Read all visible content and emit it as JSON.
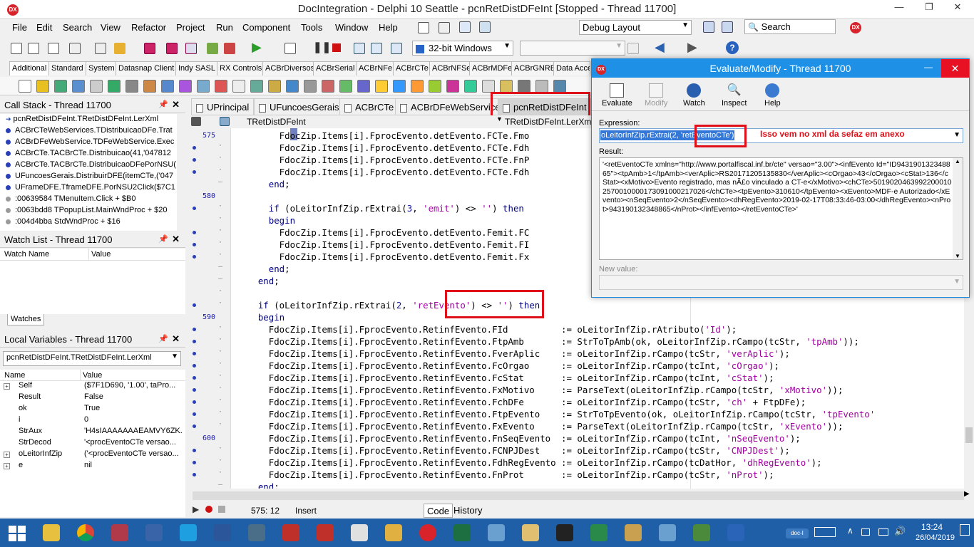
{
  "window": {
    "title": "DocIntegration - Delphi 10 Seattle - pcnRetDistDFeInt [Stopped - Thread 11700]",
    "minimize": "—",
    "restore": "❐",
    "close": "✕"
  },
  "menu": [
    "File",
    "Edit",
    "Search",
    "View",
    "Refactor",
    "Project",
    "Run",
    "Component",
    "Tools",
    "Window",
    "Help"
  ],
  "toolbar": {
    "layout_combo": "Debug Layout",
    "search_placeholder": "Search",
    "platform_combo": "32-bit Windows"
  },
  "palette_tabs": [
    "Additional",
    "Standard",
    "System",
    "Datasnap Client",
    "Indy SASL",
    "RX Controls",
    "ACBrDiversos",
    "ACBrSerial",
    "ACBrNFe",
    "ACBrCTe",
    "ACBrNFSe",
    "ACBrMDFe",
    "ACBrGNRE",
    "Data Acce"
  ],
  "call_stack": {
    "title": "Call Stack - Thread 11700",
    "items": [
      {
        "text": "pcnRetDistDFeInt.TRetDistDFeInt.LerXml",
        "type": "arrow"
      },
      {
        "text": "ACBrCTeWebServices.TDistribuicaoDFe.Trat",
        "type": "blue"
      },
      {
        "text": "ACBrDFeWebService.TDFeWebService.Exec",
        "type": "blue"
      },
      {
        "text": "ACBrCTe.TACBrCTe.Distribuicao(41,'047812",
        "type": "blue"
      },
      {
        "text": "ACBrCTe.TACBrCTe.DistribuicaoDFePorNSU(",
        "type": "blue"
      },
      {
        "text": "UFuncoesGerais.DistribuirDFE(itemCTe,('047",
        "type": "blue"
      },
      {
        "text": "UFrameDFE.TframeDFE.PorNSU2Click($7C1",
        "type": "blue"
      },
      {
        "text": ":00639584 TMenuItem.Click + $B0",
        "type": "gray"
      },
      {
        "text": ":0063bdd8 TPopupList.MainWndProc + $20",
        "type": "gray"
      },
      {
        "text": ":004d4bba StdWndProc + $16",
        "type": "gray"
      }
    ]
  },
  "watch_list": {
    "title": "Watch List - Thread 11700",
    "col_name": "Watch Name",
    "col_value": "Value",
    "tab": "Watches"
  },
  "local_vars": {
    "title": "Local Variables - Thread 11700",
    "scope": "pcnRetDistDFeInt.TRetDistDFeInt.LerXml",
    "col_name": "Name",
    "col_value": "Value",
    "rows": [
      {
        "name": "Self",
        "value": "($7F1D690, '1.00', taPro...",
        "expand": true
      },
      {
        "name": "Result",
        "value": "False",
        "expand": false
      },
      {
        "name": "ok",
        "value": "True",
        "expand": false
      },
      {
        "name": "i",
        "value": "0",
        "expand": false
      },
      {
        "name": "StrAux",
        "value": "'H4sIAAAAAAAEAMVY6ZK...",
        "expand": false
      },
      {
        "name": "StrDecod",
        "value": "'<procEventoCTe versao...",
        "expand": false
      },
      {
        "name": "oLeitorInfZip",
        "value": "('<procEventoCTe versao...",
        "expand": true
      },
      {
        "name": "e",
        "value": "nil",
        "expand": true
      }
    ]
  },
  "editor_tabs": [
    "UPrincipal",
    "UFuncoesGerais",
    "ACBrCTe",
    "ACBrDFeWebService",
    "pcnRetDistDFeInt"
  ],
  "editor_nav": {
    "class_combo": "TRetDistDFeInt",
    "method_combo": "TRetDistDFeInt.LerXm"
  },
  "line_numbers": [
    {
      "n": "575",
      "row": 0
    },
    {
      "n": "580",
      "row": 5
    },
    {
      "n": "590",
      "row": 15
    },
    {
      "n": "600",
      "row": 25
    }
  ],
  "code_lines": [
    "        FdocZip.Items[i].FprocEvento.detEvento.FCTe.Fmo",
    "        FdocZip.Items[i].FprocEvento.detEvento.FCTe.Fdh",
    "        FdocZip.Items[i].FprocEvento.detEvento.FCTe.FnP",
    "        FdocZip.Items[i].FprocEvento.detEvento.FCTe.Fdh",
    "      end;",
    "",
    "      if (oLeitorInfZip.rExtrai(3, 'emit') <> '') then",
    "      begin",
    "        FdocZip.Items[i].FprocEvento.detEvento.Femit.FC",
    "        FdocZip.Items[i].FprocEvento.detEvento.Femit.FI",
    "        FdocZip.Items[i].FprocEvento.detEvento.Femit.Fx",
    "      end;",
    "    end;",
    "",
    "    if (oLeitorInfZip.rExtrai(2, 'retEvento') <> '') then",
    "    begin",
    "      FdocZip.Items[i].FprocEvento.RetinfEvento.FId          := oLeitorInfZip.rAtributo('Id');",
    "      FdocZip.Items[i].FprocEvento.RetinfEvento.FtpAmb       := StrToTpAmb(ok, oLeitorInfZip.rCampo(tcStr, 'tpAmb'));",
    "      FdocZip.Items[i].FprocEvento.RetinfEvento.FverAplic    := oLeitorInfZip.rCampo(tcStr, 'verAplic');",
    "      FdocZip.Items[i].FprocEvento.RetinfEvento.FcOrgao      := oLeitorInfZip.rCampo(tcInt, 'cOrgao');",
    "      FdocZip.Items[i].FprocEvento.RetinfEvento.FcStat       := oLeitorInfZip.rCampo(tcInt, 'cStat');",
    "      FdocZip.Items[i].FprocEvento.RetinfEvento.FxMotivo     := ParseText(oLeitorInfZip.rCampo(tcStr, 'xMotivo'));",
    "      FdocZip.Items[i].FprocEvento.RetinfEvento.FchDFe       := oLeitorInfZip.rCampo(tcStr, 'ch' + FtpDFe);",
    "      FdocZip.Items[i].FprocEvento.RetinfEvento.FtpEvento    := StrToTpEvento(ok, oLeitorInfZip.rCampo(tcStr, 'tpEvento'",
    "      FdocZip.Items[i].FprocEvento.RetinfEvento.FxEvento     := ParseText(oLeitorInfZip.rCampo(tcStr, 'xEvento'));",
    "      FdocZip.Items[i].FprocEvento.RetinfEvento.FnSeqEvento  := oLeitorInfZip.rCampo(tcInt, 'nSeqEvento');",
    "      FdocZip.Items[i].FprocEvento.RetinfEvento.FCNPJDest    := oLeitorInfZip.rCampo(tcStr, 'CNPJDest');",
    "      FdocZip.Items[i].FprocEvento.RetinfEvento.FdhRegEvento := oLeitorInfZip.rCampo(tcDatHor, 'dhRegEvento');",
    "      FdocZip.Items[i].FprocEvento.RetinfEvento.FnProt       := oLeitorInfZip.rCampo(tcStr, 'nProt');",
    "    end;"
  ],
  "status": {
    "pos": "575: 12",
    "mode": "Insert",
    "tab_code": "Code",
    "tab_history": "History"
  },
  "evaluate": {
    "title": "Evaluate/Modify - Thread 11700",
    "buttons": [
      "Evaluate",
      "Modify",
      "Watch",
      "Inspect",
      "Help"
    ],
    "expression_label": "Expression:",
    "expression": "oLeitorInfZip.rExtrai(2, 'retEventoCTe')",
    "annotation": "Isso vem no xml da sefaz em anexo",
    "result_label": "Result:",
    "result": "'<retEventoCTe xmlns=\"http://www.portalfiscal.inf.br/cte\" versao=\"3.00\"><infEvento Id=\"ID943190132348865\"><tpAmb>1</tpAmb><verAplic>RS20171205135830</verAplic><cOrgao>43</cOrgao><cStat>136</cStat><xMotivo>Evento registrado, mas nÃ£o vinculado a CT-e</xMotivo><chCTe>50190204639922000102570010000173091000217026</chCTe><tpEvento>310610</tpEvento><xEvento>MDF-e Autorizado</xEvento><nSeqEvento>2</nSeqEvento><dhRegEvento>2019-02-17T08:33:46-03:00</dhRegEvento><nProt>943190132348865</nProt></infEvento></retEventoCTe>'",
    "new_value_label": "New value:"
  },
  "taskbar": {
    "time": "13:24",
    "date": "26/04/2019",
    "apps": [
      "Explorer",
      "Chrome",
      "Database",
      "Remote",
      "Skype",
      "Word",
      "Notepad",
      "Ruby",
      "Ruby2",
      "SQL",
      "Briefcase",
      "Delphi",
      "Excel",
      "Notepad2",
      "Tools",
      "Terminal",
      "Network",
      "Paint",
      "Notepad3",
      "Chart",
      "doc-I"
    ],
    "doc_label": "doc-I"
  }
}
